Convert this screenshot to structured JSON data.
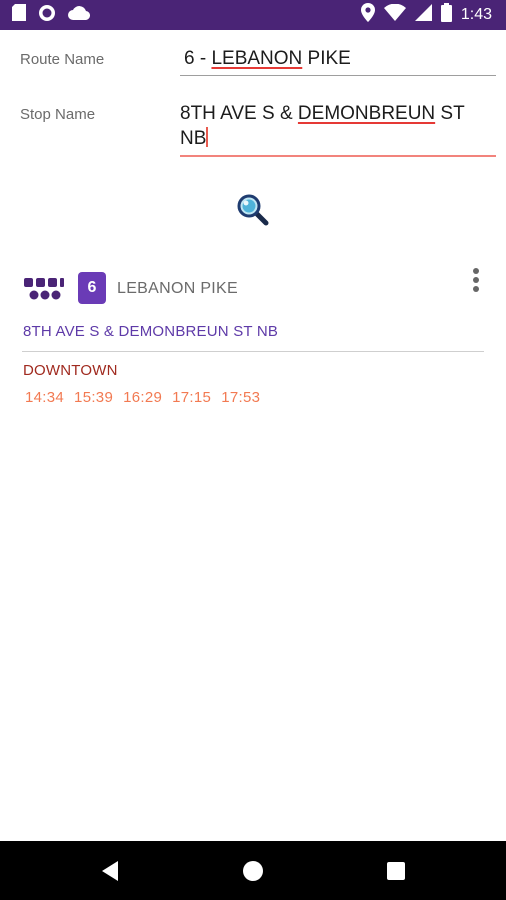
{
  "status_bar": {
    "time": "1:43",
    "icons_left": [
      "sd-card-icon",
      "circle-app-icon",
      "cloud-icon"
    ],
    "icons_right": [
      "location-icon",
      "wifi-icon",
      "cell-signal-icon",
      "battery-icon"
    ]
  },
  "form": {
    "route_label": "Route Name",
    "route_value_prefix": "6 - ",
    "route_value_spell": "LEBANON",
    "route_value_suffix": " PIKE",
    "stop_label": "Stop Name",
    "stop_value_prefix": "8TH AVE S & ",
    "stop_value_spell": "DEMONBREUN",
    "stop_value_suffix": " ST NB"
  },
  "search": {
    "icon": "magnifier-icon"
  },
  "result": {
    "route_number": "6",
    "route_name": "LEBANON PIKE",
    "stop_name": "8TH AVE S & DEMONBREUN ST NB",
    "direction": "DOWNTOWN",
    "times": [
      "14:34",
      "15:39",
      "16:29",
      "17:15",
      "17:53"
    ]
  },
  "nav_bar": {
    "buttons": [
      "back-icon",
      "home-icon",
      "recents-icon"
    ]
  },
  "colors": {
    "status_bar": "#4a2476",
    "accent_purple": "#6a3bb6",
    "stop_link": "#5e3aa8",
    "direction": "#a02a1f",
    "times": "#f27a52",
    "input_focus_line": "#f2837c"
  }
}
